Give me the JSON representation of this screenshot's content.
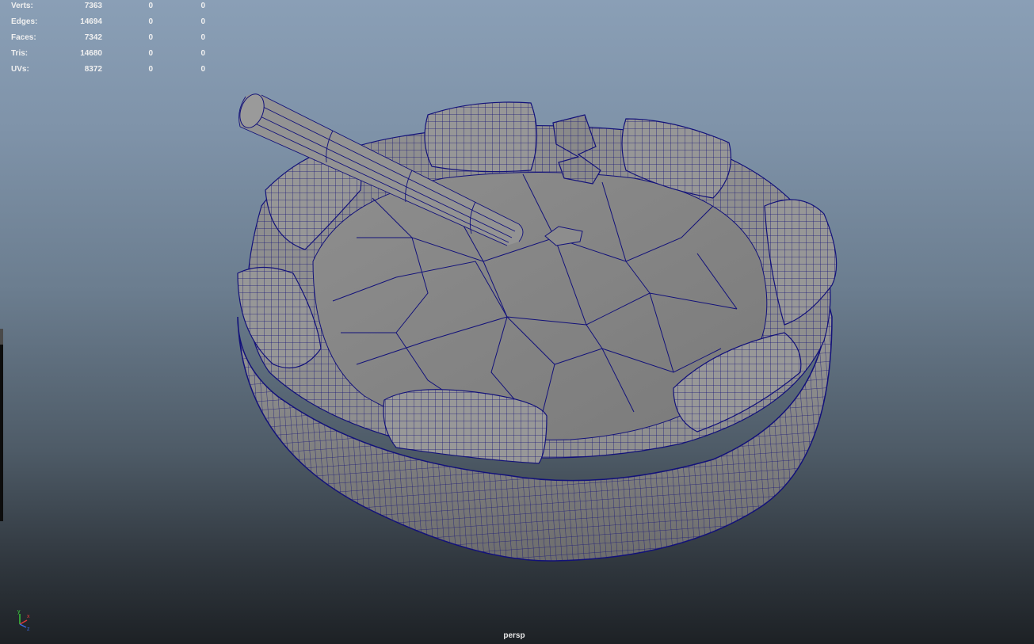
{
  "viewport": {
    "camera_name": "persp",
    "heads_up_display": {
      "rows": [
        {
          "label": "Verts:",
          "values": [
            "7363",
            "0",
            "0"
          ]
        },
        {
          "label": "Edges:",
          "values": [
            "14694",
            "0",
            "0"
          ]
        },
        {
          "label": "Faces:",
          "values": [
            "7342",
            "0",
            "0"
          ]
        },
        {
          "label": "Tris:",
          "values": [
            "14680",
            "0",
            "0"
          ]
        },
        {
          "label": "UVs:",
          "values": [
            "8372",
            "0",
            "0"
          ]
        }
      ]
    },
    "axis_gizmo": {
      "y_label": "y",
      "x_label": "x",
      "z_label": "z"
    },
    "model": "ashtray-wireframe-mesh",
    "colors": {
      "background_top": "#8a9fb6",
      "background_bottom": "#1d2125",
      "wireframe": "#12117a",
      "mesh_surface": "#8c8c8c",
      "hud_text": "#f0f0f0"
    }
  }
}
